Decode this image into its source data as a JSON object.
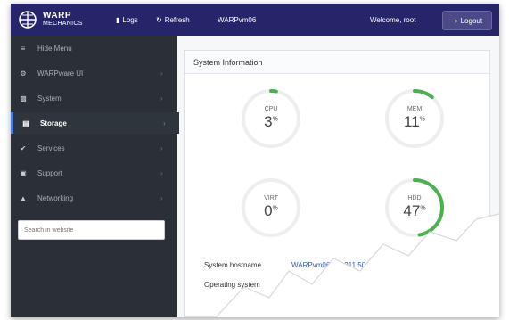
{
  "topbar": {
    "brand_line1": "WARP",
    "brand_line2": "MECHANICS",
    "logs_label": "Logs",
    "refresh_label": "Refresh",
    "hostname": "WARPvm06",
    "welcome": "Welcome, root",
    "logout_label": "Logout"
  },
  "sidebar": {
    "items": [
      {
        "label": "Hide Menu",
        "icon": "menu-icon"
      },
      {
        "label": "WARPware UI",
        "icon": "gear-icon"
      },
      {
        "label": "System",
        "icon": "chart-icon"
      },
      {
        "label": "Storage",
        "icon": "storage-icon"
      },
      {
        "label": "Services",
        "icon": "wrench-icon"
      },
      {
        "label": "Support",
        "icon": "support-icon"
      },
      {
        "label": "Networking",
        "icon": "network-icon"
      }
    ],
    "search_placeholder": "Search in website"
  },
  "main": {
    "panel_title": "System Information",
    "gauges": [
      {
        "label": "CPU",
        "value": "3",
        "unit": "%",
        "percent": 3
      },
      {
        "label": "MEM",
        "value": "11",
        "unit": "%",
        "percent": 11
      },
      {
        "label": "VIRT",
        "value": "0",
        "unit": "%",
        "percent": 0
      },
      {
        "label": "HDD",
        "value": "47",
        "unit": "%",
        "percent": 47
      }
    ],
    "info": [
      {
        "key": "System hostname",
        "value": "WARPvm06 (10.211.50.6)"
      },
      {
        "key": "Operating system",
        "value": ""
      }
    ]
  },
  "colors": {
    "topbar": "#27256a",
    "sidebar": "#2b3036",
    "gauge_fill": "#4caf50",
    "gauge_track": "#eeeeee"
  }
}
